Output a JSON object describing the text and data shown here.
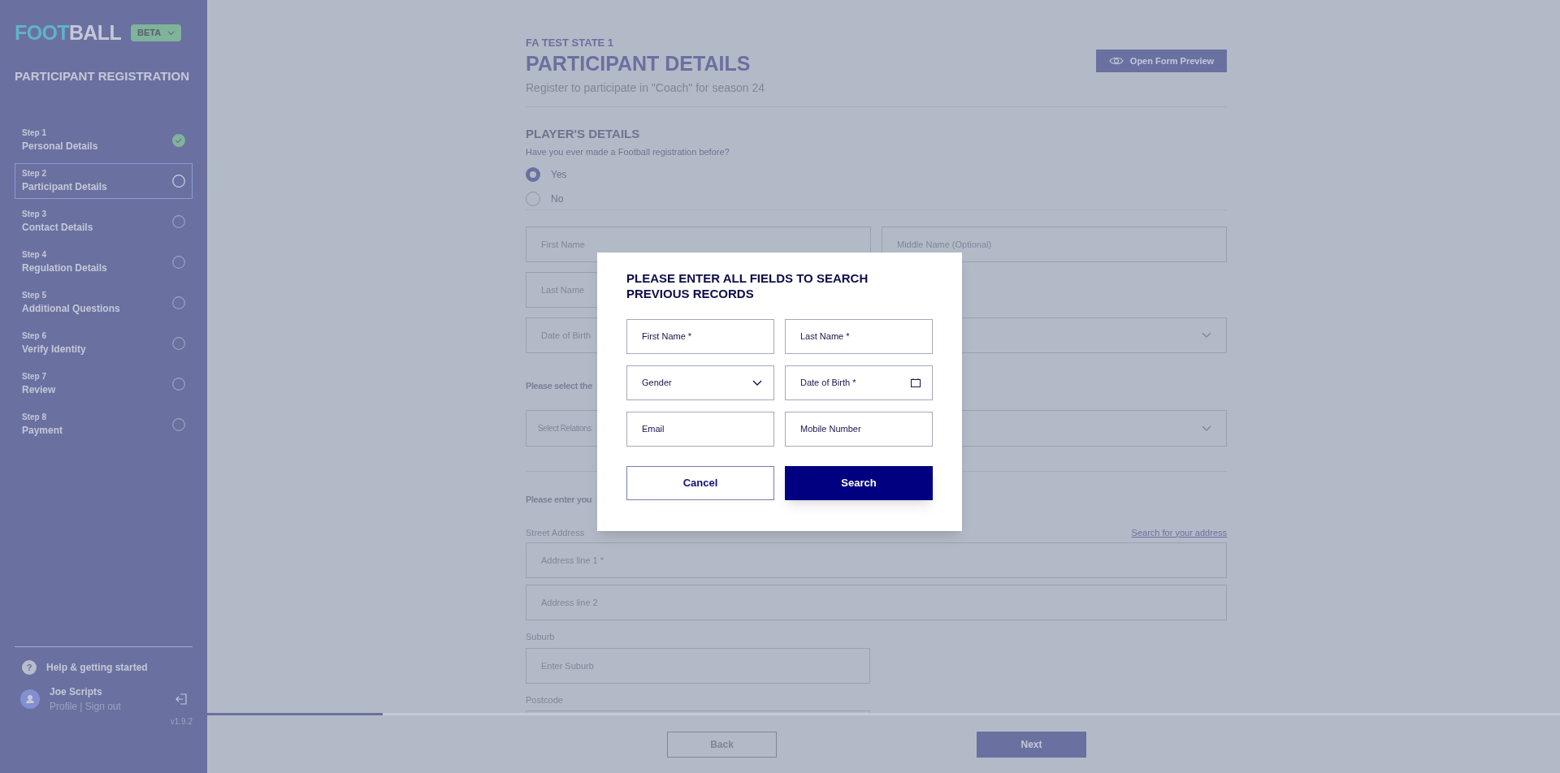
{
  "sidebar": {
    "logo": {
      "first": "FOOT",
      "second": "BALL"
    },
    "badge": "BETA",
    "heading": "PARTICIPANT REGISTRATION",
    "steps": [
      {
        "step": "Step 1",
        "label": "Personal Details",
        "completed": true,
        "selected": false
      },
      {
        "step": "Step 2",
        "label": "Participant Details",
        "completed": false,
        "selected": true
      },
      {
        "step": "Step 3",
        "label": "Contact Details",
        "completed": false,
        "selected": false
      },
      {
        "step": "Step 4",
        "label": "Regulation Details",
        "completed": false,
        "selected": false
      },
      {
        "step": "Step 5",
        "label": "Additional Questions",
        "completed": false,
        "selected": false
      },
      {
        "step": "Step 6",
        "label": "Verify Identity",
        "completed": false,
        "selected": false
      },
      {
        "step": "Step 7",
        "label": "Review",
        "completed": false,
        "selected": false
      },
      {
        "step": "Step 8",
        "label": "Payment",
        "completed": false,
        "selected": false
      }
    ],
    "help": {
      "icon": "?",
      "label": "Help & getting started"
    },
    "user": {
      "name": "Joe Scripts",
      "links": "Profile | Sign out"
    },
    "version": "v1.9.2"
  },
  "header": {
    "overline": "FA TEST STATE 1",
    "title": "PARTICIPANT DETAILS",
    "subtitle": "Register to participate in \"Coach\" for season 24",
    "preview_button": "Open Form Preview"
  },
  "players_details": {
    "heading": "PLAYER'S DETAILS",
    "question": "Have you ever made a Football registration before?",
    "options": [
      {
        "label": "Yes",
        "selected": true
      },
      {
        "label": "No",
        "selected": false
      }
    ]
  },
  "form_rows": [
    [
      {
        "kind": "text",
        "placeholder": "First Name"
      },
      {
        "kind": "text",
        "placeholder": "Middle Name (Optional)"
      }
    ],
    [
      {
        "kind": "text",
        "placeholder": "Last Name"
      }
    ],
    [
      {
        "kind": "text",
        "placeholder": "Date of Birth"
      },
      {
        "kind": "select"
      }
    ]
  ],
  "relationship": {
    "prompt": "Please select the",
    "placeholder": "Select Relations"
  },
  "address": {
    "prompt": "Please enter you",
    "street_label": "Street Address",
    "search_link": "Search for your address",
    "line1": "Address line 1 *",
    "line2": "Address line 2",
    "suburb_label": "Suburb",
    "suburb_placeholder": "Enter Suburb",
    "postcode_label": "Postcode"
  },
  "progress": {
    "level": 0.13
  },
  "footer": {
    "back": "Back",
    "next": "Next"
  },
  "modal": {
    "title": "PLEASE ENTER ALL FIELDS TO SEARCH PREVIOUS RECORDS",
    "fields": [
      {
        "kind": "text",
        "placeholder": "First Name *"
      },
      {
        "kind": "text",
        "placeholder": "Last Name *"
      },
      {
        "kind": "select",
        "placeholder": "Gender"
      },
      {
        "kind": "date",
        "placeholder": "Date of Birth *"
      },
      {
        "kind": "text",
        "placeholder": "Email"
      },
      {
        "kind": "text",
        "placeholder": "Mobile Number"
      }
    ],
    "cancel": "Cancel",
    "search": "Search"
  }
}
